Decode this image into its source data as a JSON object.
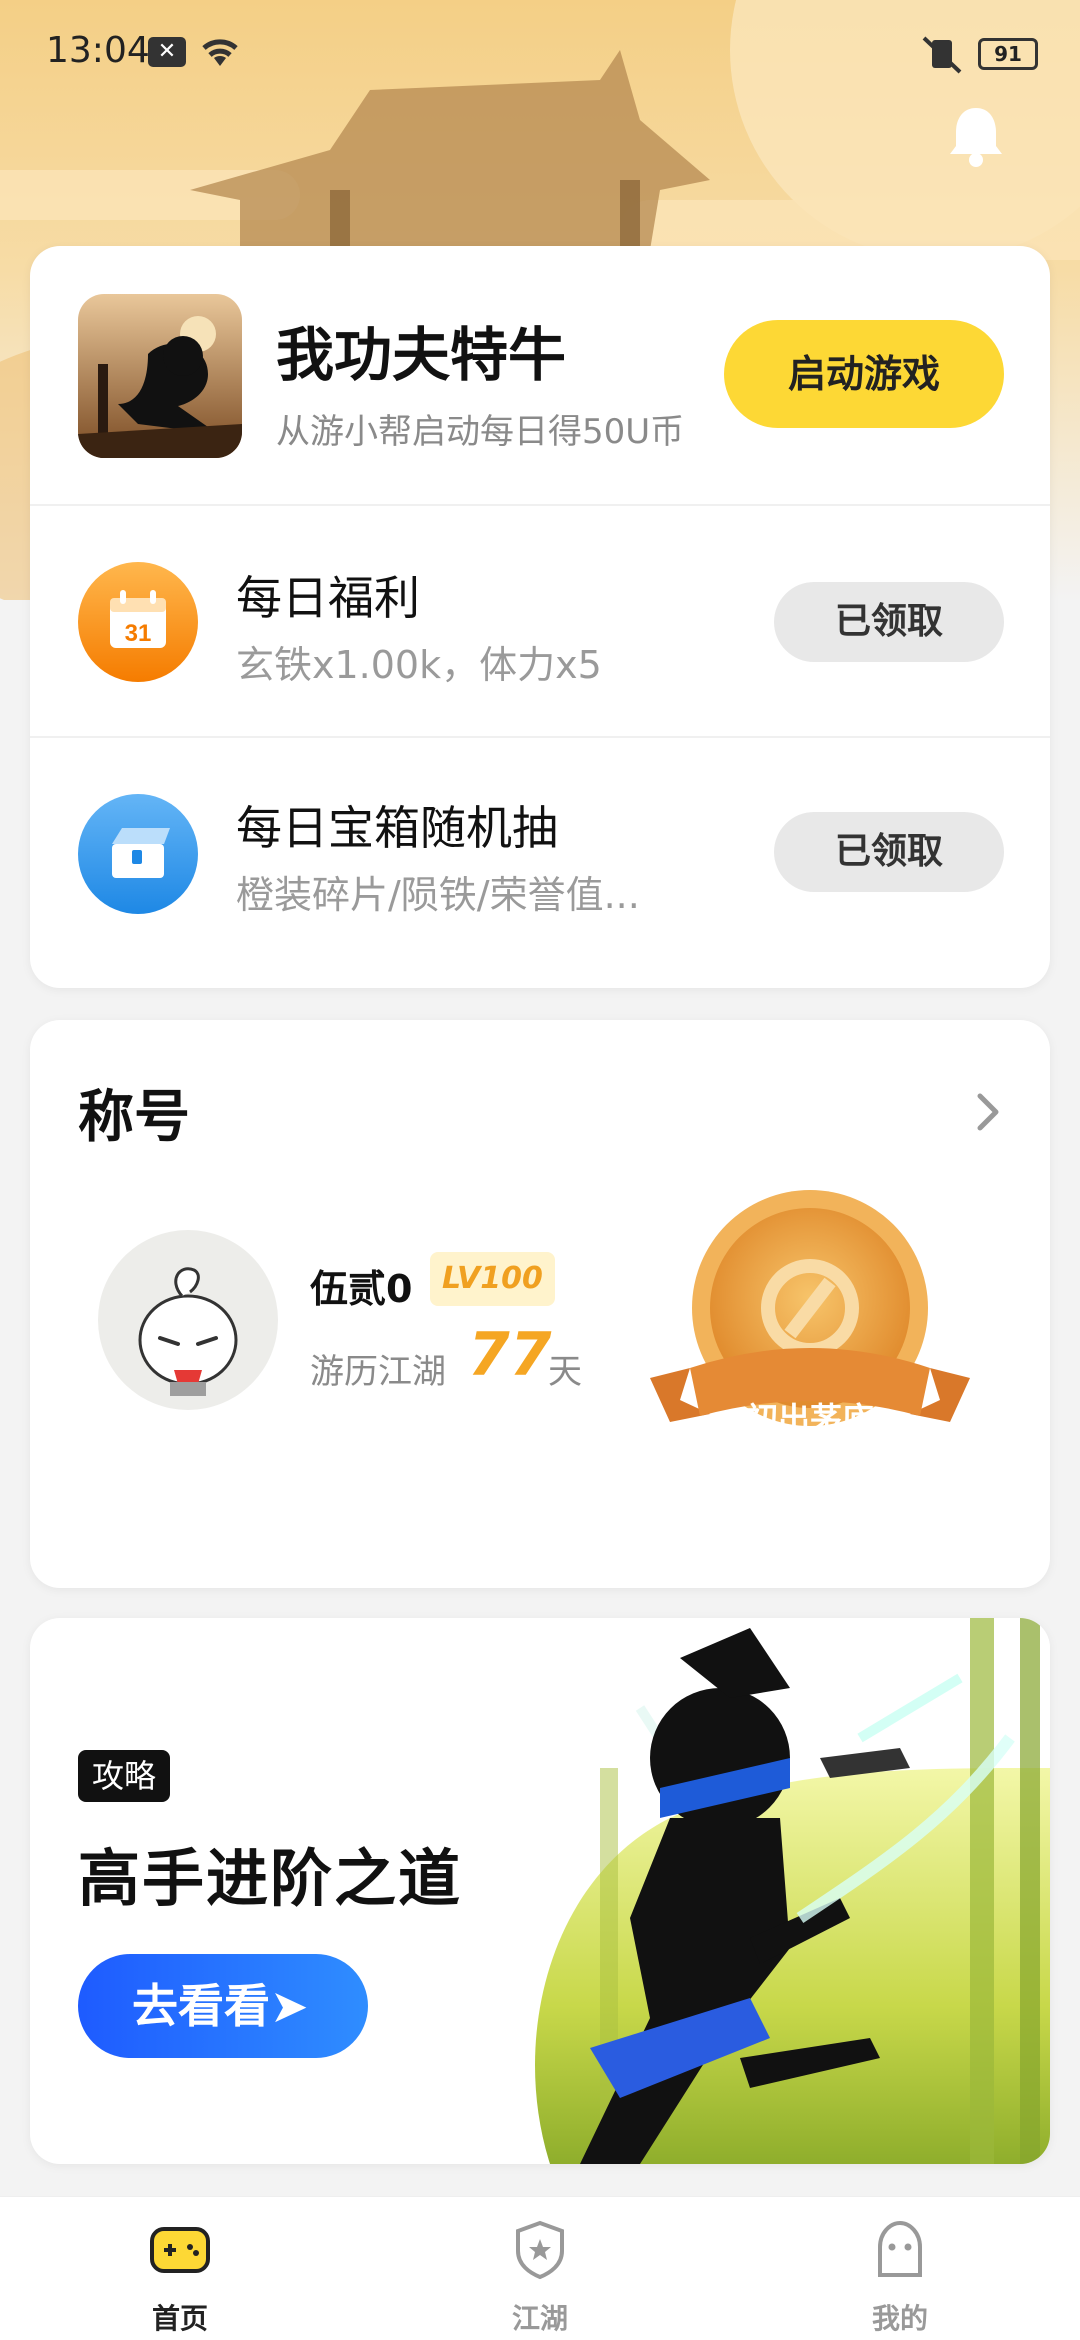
{
  "status_bar": {
    "time": "13:04",
    "battery": "91"
  },
  "game": {
    "title": "我功夫特牛",
    "subtitle": "从游小帮启动每日得50U币",
    "launch_label": "启动游戏"
  },
  "rewards": [
    {
      "title": "每日福利",
      "subtitle": "玄铁x1.00k，体力x5",
      "button": "已领取",
      "icon": "calendar-icon",
      "icon_text": "31"
    },
    {
      "title": "每日宝箱随机抽",
      "subtitle": "橙装碎片/陨铁/荣誉值...",
      "button": "已领取",
      "icon": "treasure-box-icon"
    }
  ],
  "title_section": {
    "heading": "称号",
    "user_name": "伍贰0",
    "level": "LV100",
    "travel_label": "游历江湖",
    "days": "77",
    "days_unit": "天",
    "medal_name": "初出茅庐"
  },
  "promo": {
    "tag": "攻略",
    "title": "高手进阶之道",
    "button": "去看看➤"
  },
  "nav": [
    {
      "label": "首页",
      "icon": "gamepad-icon",
      "active": true
    },
    {
      "label": "江湖",
      "icon": "shield-star-icon",
      "active": false
    },
    {
      "label": "我的",
      "icon": "ghost-icon",
      "active": false
    }
  ],
  "colors": {
    "accent_yellow": "#fdd835",
    "accent_blue": "#1e5bff",
    "orange": "#f5a623"
  }
}
